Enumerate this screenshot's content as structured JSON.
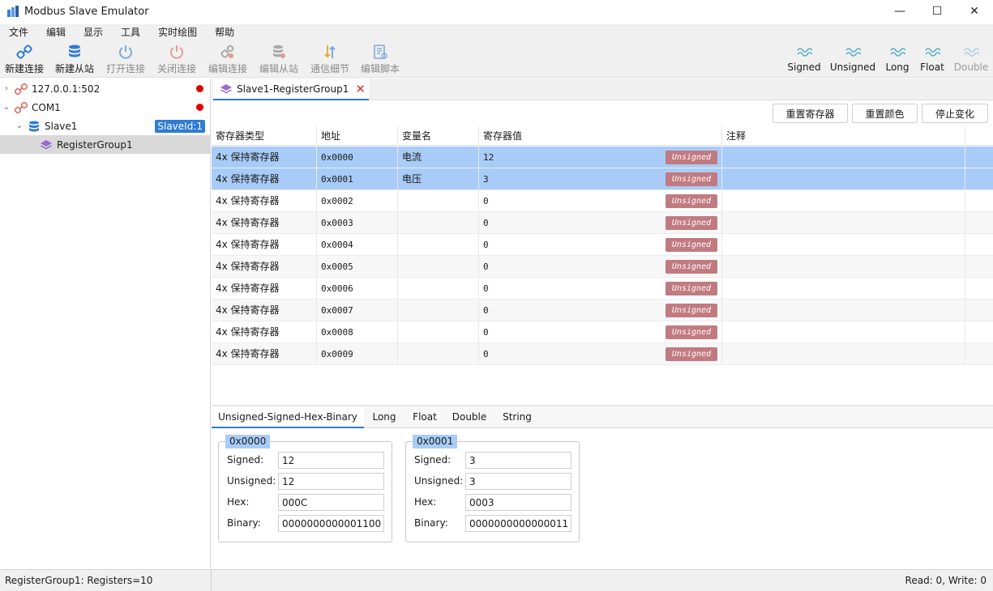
{
  "app": {
    "title": "Modbus Slave Emulator",
    "icon": "app-icon",
    "window_controls": {
      "minimize": "—",
      "maximize": "☐",
      "close": "✕"
    }
  },
  "menu": [
    "文件",
    "编辑",
    "显示",
    "工具",
    "实时绘图",
    "帮助"
  ],
  "toolbar": {
    "left": [
      {
        "label": "新建连接",
        "icon": "link-icon",
        "enabled": true
      },
      {
        "label": "新建从站",
        "icon": "database-icon",
        "enabled": true
      },
      {
        "label": "打开连接",
        "icon": "power-icon",
        "enabled": false
      },
      {
        "label": "关闭连接",
        "icon": "power-off-icon",
        "enabled": false
      },
      {
        "label": "编辑连接",
        "icon": "edit-link-icon",
        "enabled": false
      },
      {
        "label": "编辑从站",
        "icon": "edit-database-icon",
        "enabled": false
      },
      {
        "label": "通信细节",
        "icon": "transfer-icon",
        "enabled": false
      },
      {
        "label": "编辑脚本",
        "icon": "script-icon",
        "enabled": false
      }
    ],
    "right": [
      {
        "label": "Signed",
        "icon": "wave-icon",
        "enabled": true
      },
      {
        "label": "Unsigned",
        "icon": "wave-icon",
        "enabled": true
      },
      {
        "label": "Long",
        "icon": "wave-icon",
        "enabled": true
      },
      {
        "label": "Float",
        "icon": "wave-icon",
        "enabled": true
      },
      {
        "label": "Double",
        "icon": "wave-icon",
        "enabled": false
      }
    ]
  },
  "tree": {
    "nodes": [
      {
        "label": "127.0.0.1:502",
        "icon": "link-icon",
        "expanded": false,
        "status": "disconnected"
      },
      {
        "label": "COM1",
        "icon": "link-icon",
        "expanded": true,
        "status": "disconnected"
      },
      {
        "label": "Slave1",
        "icon": "database-icon",
        "expanded": true,
        "badge": "SlaveId:1"
      },
      {
        "label": "RegisterGroup1",
        "icon": "layers-icon",
        "selected": true
      }
    ]
  },
  "doc_tab": {
    "label": "Slave1-RegisterGroup1",
    "close": "✕"
  },
  "actions": [
    "重置寄存器",
    "重置颜色",
    "停止变化"
  ],
  "grid": {
    "columns": [
      "寄存器类型",
      "地址",
      "变量名",
      "寄存器值",
      "注释"
    ],
    "rows": [
      {
        "type": "4x 保持寄存器",
        "address": "0x0000",
        "name": "电流",
        "value": "12",
        "format": "Unsigned",
        "comment": "",
        "selected": true
      },
      {
        "type": "4x 保持寄存器",
        "address": "0x0001",
        "name": "电压",
        "value": "3",
        "format": "Unsigned",
        "comment": "",
        "selected": true
      },
      {
        "type": "4x 保持寄存器",
        "address": "0x0002",
        "name": "",
        "value": "0",
        "format": "Unsigned",
        "comment": ""
      },
      {
        "type": "4x 保持寄存器",
        "address": "0x0003",
        "name": "",
        "value": "0",
        "format": "Unsigned",
        "comment": ""
      },
      {
        "type": "4x 保持寄存器",
        "address": "0x0004",
        "name": "",
        "value": "0",
        "format": "Unsigned",
        "comment": ""
      },
      {
        "type": "4x 保持寄存器",
        "address": "0x0005",
        "name": "",
        "value": "0",
        "format": "Unsigned",
        "comment": ""
      },
      {
        "type": "4x 保持寄存器",
        "address": "0x0006",
        "name": "",
        "value": "0",
        "format": "Unsigned",
        "comment": ""
      },
      {
        "type": "4x 保持寄存器",
        "address": "0x0007",
        "name": "",
        "value": "0",
        "format": "Unsigned",
        "comment": ""
      },
      {
        "type": "4x 保持寄存器",
        "address": "0x0008",
        "name": "",
        "value": "0",
        "format": "Unsigned",
        "comment": ""
      },
      {
        "type": "4x 保持寄存器",
        "address": "0x0009",
        "name": "",
        "value": "0",
        "format": "Unsigned",
        "comment": ""
      }
    ]
  },
  "bottom_tabs": [
    "Unsigned-Signed-Hex-Binary",
    "Long",
    "Float",
    "Double",
    "String"
  ],
  "register_details": [
    {
      "title": "0x0000",
      "fields": [
        {
          "label": "Signed:",
          "value": "12"
        },
        {
          "label": "Unsigned:",
          "value": "12"
        },
        {
          "label": "Hex:",
          "value": "000C"
        },
        {
          "label": "Binary:",
          "value": "0000000000001100"
        }
      ]
    },
    {
      "title": "0x0001",
      "fields": [
        {
          "label": "Signed:",
          "value": "3"
        },
        {
          "label": "Unsigned:",
          "value": "3"
        },
        {
          "label": "Hex:",
          "value": "0003"
        },
        {
          "label": "Binary:",
          "value": "0000000000000011"
        }
      ]
    }
  ],
  "status": {
    "left": "RegisterGroup1: Registers=10",
    "right": "Read: 0, Write: 0"
  },
  "colors": {
    "accent": "#2f7bd6",
    "selection": "#a8ccf7",
    "badge_unsigned": "#c17a80",
    "status_dot": "#e00000"
  }
}
